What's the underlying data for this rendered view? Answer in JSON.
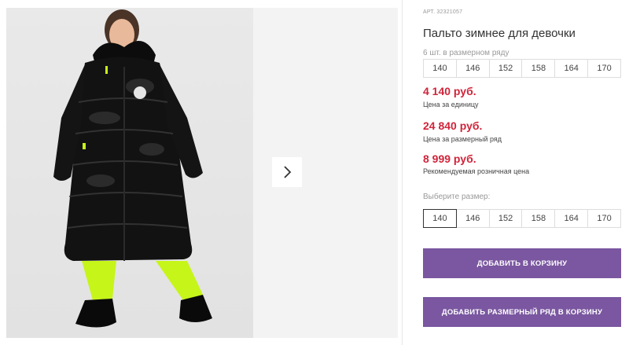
{
  "product": {
    "article": "АРТ. 32321057",
    "title": "Пальто зимнее для девочки",
    "row_count": "6 шт. в размерном ряду"
  },
  "row_sizes": [
    "140",
    "146",
    "152",
    "158",
    "164",
    "170"
  ],
  "prices": {
    "unit_price": "4 140 руб.",
    "unit_label": "Цена за единицу",
    "row_price": "24 840 руб.",
    "row_label": "Цена за размерный ряд",
    "retail_price": "8 999 руб.",
    "retail_label": "Рекомендуемая розничная цена"
  },
  "size_select": {
    "label": "Выберите размер:",
    "options": [
      "140",
      "146",
      "152",
      "158",
      "164",
      "170"
    ],
    "selected": "140"
  },
  "buttons": {
    "add_to_cart": "ДОБАВИТЬ В КОРЗИНУ",
    "add_row_to_cart": "ДОБАВИТЬ РАЗМЕРНЫЙ РЯД В КОРЗИНУ"
  },
  "colors": {
    "price_red": "#d0243a",
    "button_purple": "#7a57a0",
    "coat": "#111111",
    "pants_neon": "#c6f51a"
  },
  "icons": {
    "gallery_next": "chevron-right-icon"
  }
}
